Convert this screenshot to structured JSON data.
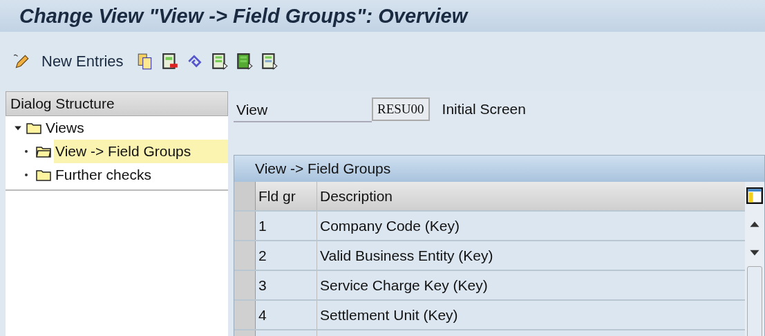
{
  "window": {
    "title": "Change View \"View -> Field Groups\": Overview"
  },
  "toolbar": {
    "new_entries": "New Entries"
  },
  "dialog_structure": {
    "title": "Dialog Structure",
    "items": [
      {
        "label": "Views",
        "expanded": true,
        "selected": false,
        "children": [
          {
            "label": "View -> Field Groups",
            "selected": true,
            "kind": "open"
          },
          {
            "label": "Further checks",
            "selected": false,
            "kind": "closed"
          }
        ]
      }
    ]
  },
  "view_field": {
    "label": "View",
    "value": "RESU00",
    "description": "Initial Screen"
  },
  "table": {
    "title": "View -> Field Groups",
    "columns": [
      "Fld gr",
      "Description"
    ],
    "rows": [
      {
        "fld_gr": "1",
        "description": "Company Code (Key)"
      },
      {
        "fld_gr": "2",
        "description": "Valid Business Entity (Key)"
      },
      {
        "fld_gr": "3",
        "description": "Service Charge Key (Key)"
      },
      {
        "fld_gr": "4",
        "description": "Settlement Unit (Key)"
      }
    ]
  }
}
